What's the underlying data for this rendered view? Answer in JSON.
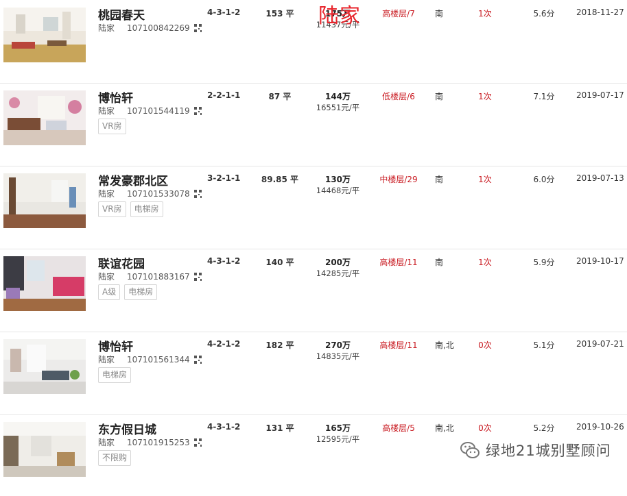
{
  "overlay_text": "陆家",
  "watermark": {
    "text": "绿地21城别墅顾问",
    "icon": "wechat-icon"
  },
  "listings": [
    {
      "name": "桃园春天",
      "district": "陆家",
      "code": "107100842269",
      "tags": [],
      "layout": "4-3-1-2",
      "area": "153 平",
      "price": "175万",
      "unit_price": "11437元/平",
      "floor": "高楼层/7",
      "orientation": "南",
      "visits": "1次",
      "score": "5.6分",
      "date": "2018-11-27"
    },
    {
      "name": "博怡轩",
      "district": "陆家",
      "code": "107101544119",
      "tags": [
        "VR房"
      ],
      "layout": "2-2-1-1",
      "area": "87 平",
      "price": "144万",
      "unit_price": "16551元/平",
      "floor": "低楼层/6",
      "orientation": "南",
      "visits": "1次",
      "score": "7.1分",
      "date": "2019-07-17"
    },
    {
      "name": "常发豪郡北区",
      "district": "陆家",
      "code": "107101533078",
      "tags": [
        "VR房",
        "电梯房"
      ],
      "layout": "3-2-1-1",
      "area": "89.85 平",
      "price": "130万",
      "unit_price": "14468元/平",
      "floor": "中楼层/29",
      "orientation": "南",
      "visits": "1次",
      "score": "6.0分",
      "date": "2019-07-13"
    },
    {
      "name": "联谊花园",
      "district": "陆家",
      "code": "107101883167",
      "tags": [
        "A级",
        "电梯房"
      ],
      "layout": "4-3-1-2",
      "area": "140 平",
      "price": "200万",
      "unit_price": "14285元/平",
      "floor": "高楼层/11",
      "orientation": "南",
      "visits": "1次",
      "score": "5.9分",
      "date": "2019-10-17"
    },
    {
      "name": "博怡轩",
      "district": "陆家",
      "code": "107101561344",
      "tags": [
        "电梯房"
      ],
      "layout": "4-2-1-2",
      "area": "182 平",
      "price": "270万",
      "unit_price": "14835元/平",
      "floor": "高楼层/11",
      "orientation": "南,北",
      "visits": "0次",
      "score": "5.1分",
      "date": "2019-07-21"
    },
    {
      "name": "东方假日城",
      "district": "陆家",
      "code": "107101915253",
      "tags": [
        "不限购"
      ],
      "layout": "4-3-1-2",
      "area": "131 平",
      "price": "165万",
      "unit_price": "12595元/平",
      "floor": "高楼层/5",
      "orientation": "南,北",
      "visits": "0次",
      "score": "5.2分",
      "date": "2019-10-26"
    }
  ]
}
